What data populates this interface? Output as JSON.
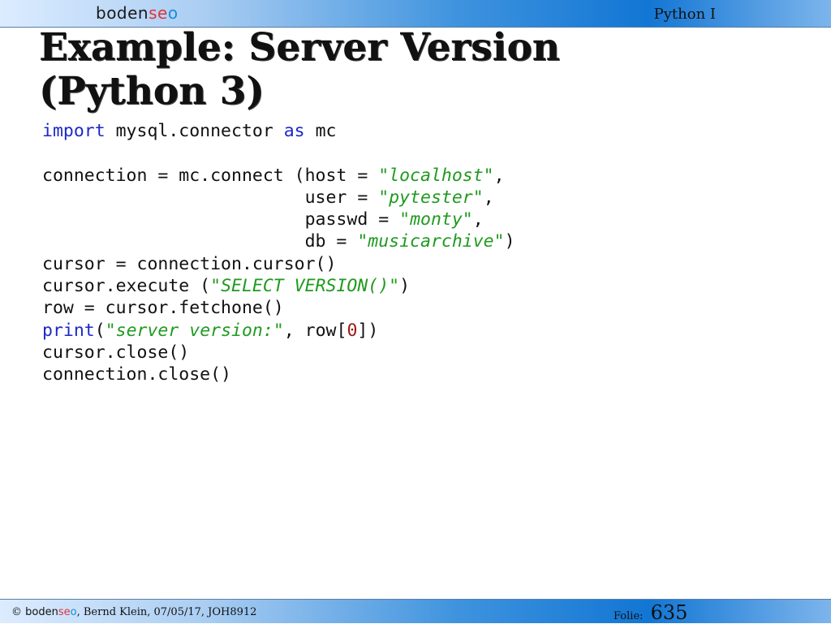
{
  "header": {
    "logo_prefix": "boden",
    "logo_mid": "se",
    "logo_suffix": "o",
    "title": "Python I"
  },
  "slide": {
    "title": "Example:  Server Version (Python 3)"
  },
  "code": {
    "lines": [
      [
        {
          "t": "import",
          "c": "kw"
        },
        {
          "t": " mysql.connector "
        },
        {
          "t": "as",
          "c": "kw"
        },
        {
          "t": " mc"
        }
      ],
      [],
      [
        {
          "t": "connection = mc.connect (host = "
        },
        {
          "t": "\"",
          "c": "str"
        },
        {
          "t": "localhost",
          "c": "str",
          "i": true
        },
        {
          "t": "\"",
          "c": "str"
        },
        {
          "t": ","
        }
      ],
      [
        {
          "t": "                         user = "
        },
        {
          "t": "\"",
          "c": "str"
        },
        {
          "t": "pytester",
          "c": "str",
          "i": true
        },
        {
          "t": "\"",
          "c": "str"
        },
        {
          "t": ","
        }
      ],
      [
        {
          "t": "                         passwd = "
        },
        {
          "t": "\"",
          "c": "str"
        },
        {
          "t": "monty",
          "c": "str",
          "i": true
        },
        {
          "t": "\"",
          "c": "str"
        },
        {
          "t": ","
        }
      ],
      [
        {
          "t": "                         db = "
        },
        {
          "t": "\"",
          "c": "str"
        },
        {
          "t": "musicarchive",
          "c": "str",
          "i": true
        },
        {
          "t": "\"",
          "c": "str"
        },
        {
          "t": ")"
        }
      ],
      [
        {
          "t": "cursor = connection.cursor()"
        }
      ],
      [
        {
          "t": "cursor.execute ("
        },
        {
          "t": "\"",
          "c": "str"
        },
        {
          "t": "SELECT VERSION()",
          "c": "str",
          "i": true
        },
        {
          "t": "\"",
          "c": "str"
        },
        {
          "t": ")"
        }
      ],
      [
        {
          "t": "row = cursor.fetchone()"
        }
      ],
      [
        {
          "t": "print",
          "c": "kw"
        },
        {
          "t": "("
        },
        {
          "t": "\"",
          "c": "str"
        },
        {
          "t": "server version:",
          "c": "str",
          "i": true
        },
        {
          "t": "\"",
          "c": "str"
        },
        {
          "t": ", row["
        },
        {
          "t": "0",
          "c": "num"
        },
        {
          "t": "])"
        }
      ],
      [
        {
          "t": "cursor.close()"
        }
      ],
      [
        {
          "t": "connection.close()"
        }
      ]
    ]
  },
  "footer": {
    "copyright": "©",
    "logo_prefix": "boden",
    "logo_mid": "se",
    "logo_suffix": "o",
    "credits": ", Bernd Klein, 07/05/17, JOH8912",
    "folie_label": "Folie:",
    "page_number": "635"
  },
  "colors": {
    "keyword": "#1d28c8",
    "string": "#1f9a1f",
    "number": "#9b1818",
    "logo_accent": "#e2323a",
    "header_blue": "#1276d4"
  }
}
